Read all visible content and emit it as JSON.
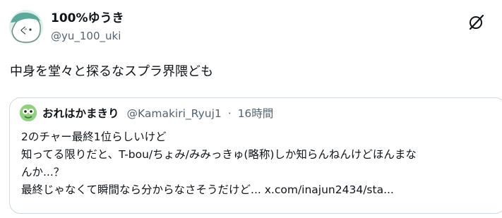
{
  "post": {
    "display_name": "100%ゆうき",
    "handle": "@yu_100_uki",
    "text": "中身を堂々と探るなスプラ界隈ども"
  },
  "icons": {
    "grok": "grok-icon",
    "avatar": "avatar",
    "quote_avatar": "avatar"
  },
  "quote": {
    "display_name": "おれはかまきり",
    "handle": "@Kamakiri_Ryuj1",
    "separator": "·",
    "time": "16時間",
    "lines": [
      "2のチャー最終1位らしいけど",
      "知ってる限りだと、T-bou/ちょみ/みみっきゅ(略称)しか知らんねんけどほんまな",
      "んか...？",
      "最終じゃなくて瞬間なら分からなさそうだけど... x.com/inajun2434/sta..."
    ]
  }
}
